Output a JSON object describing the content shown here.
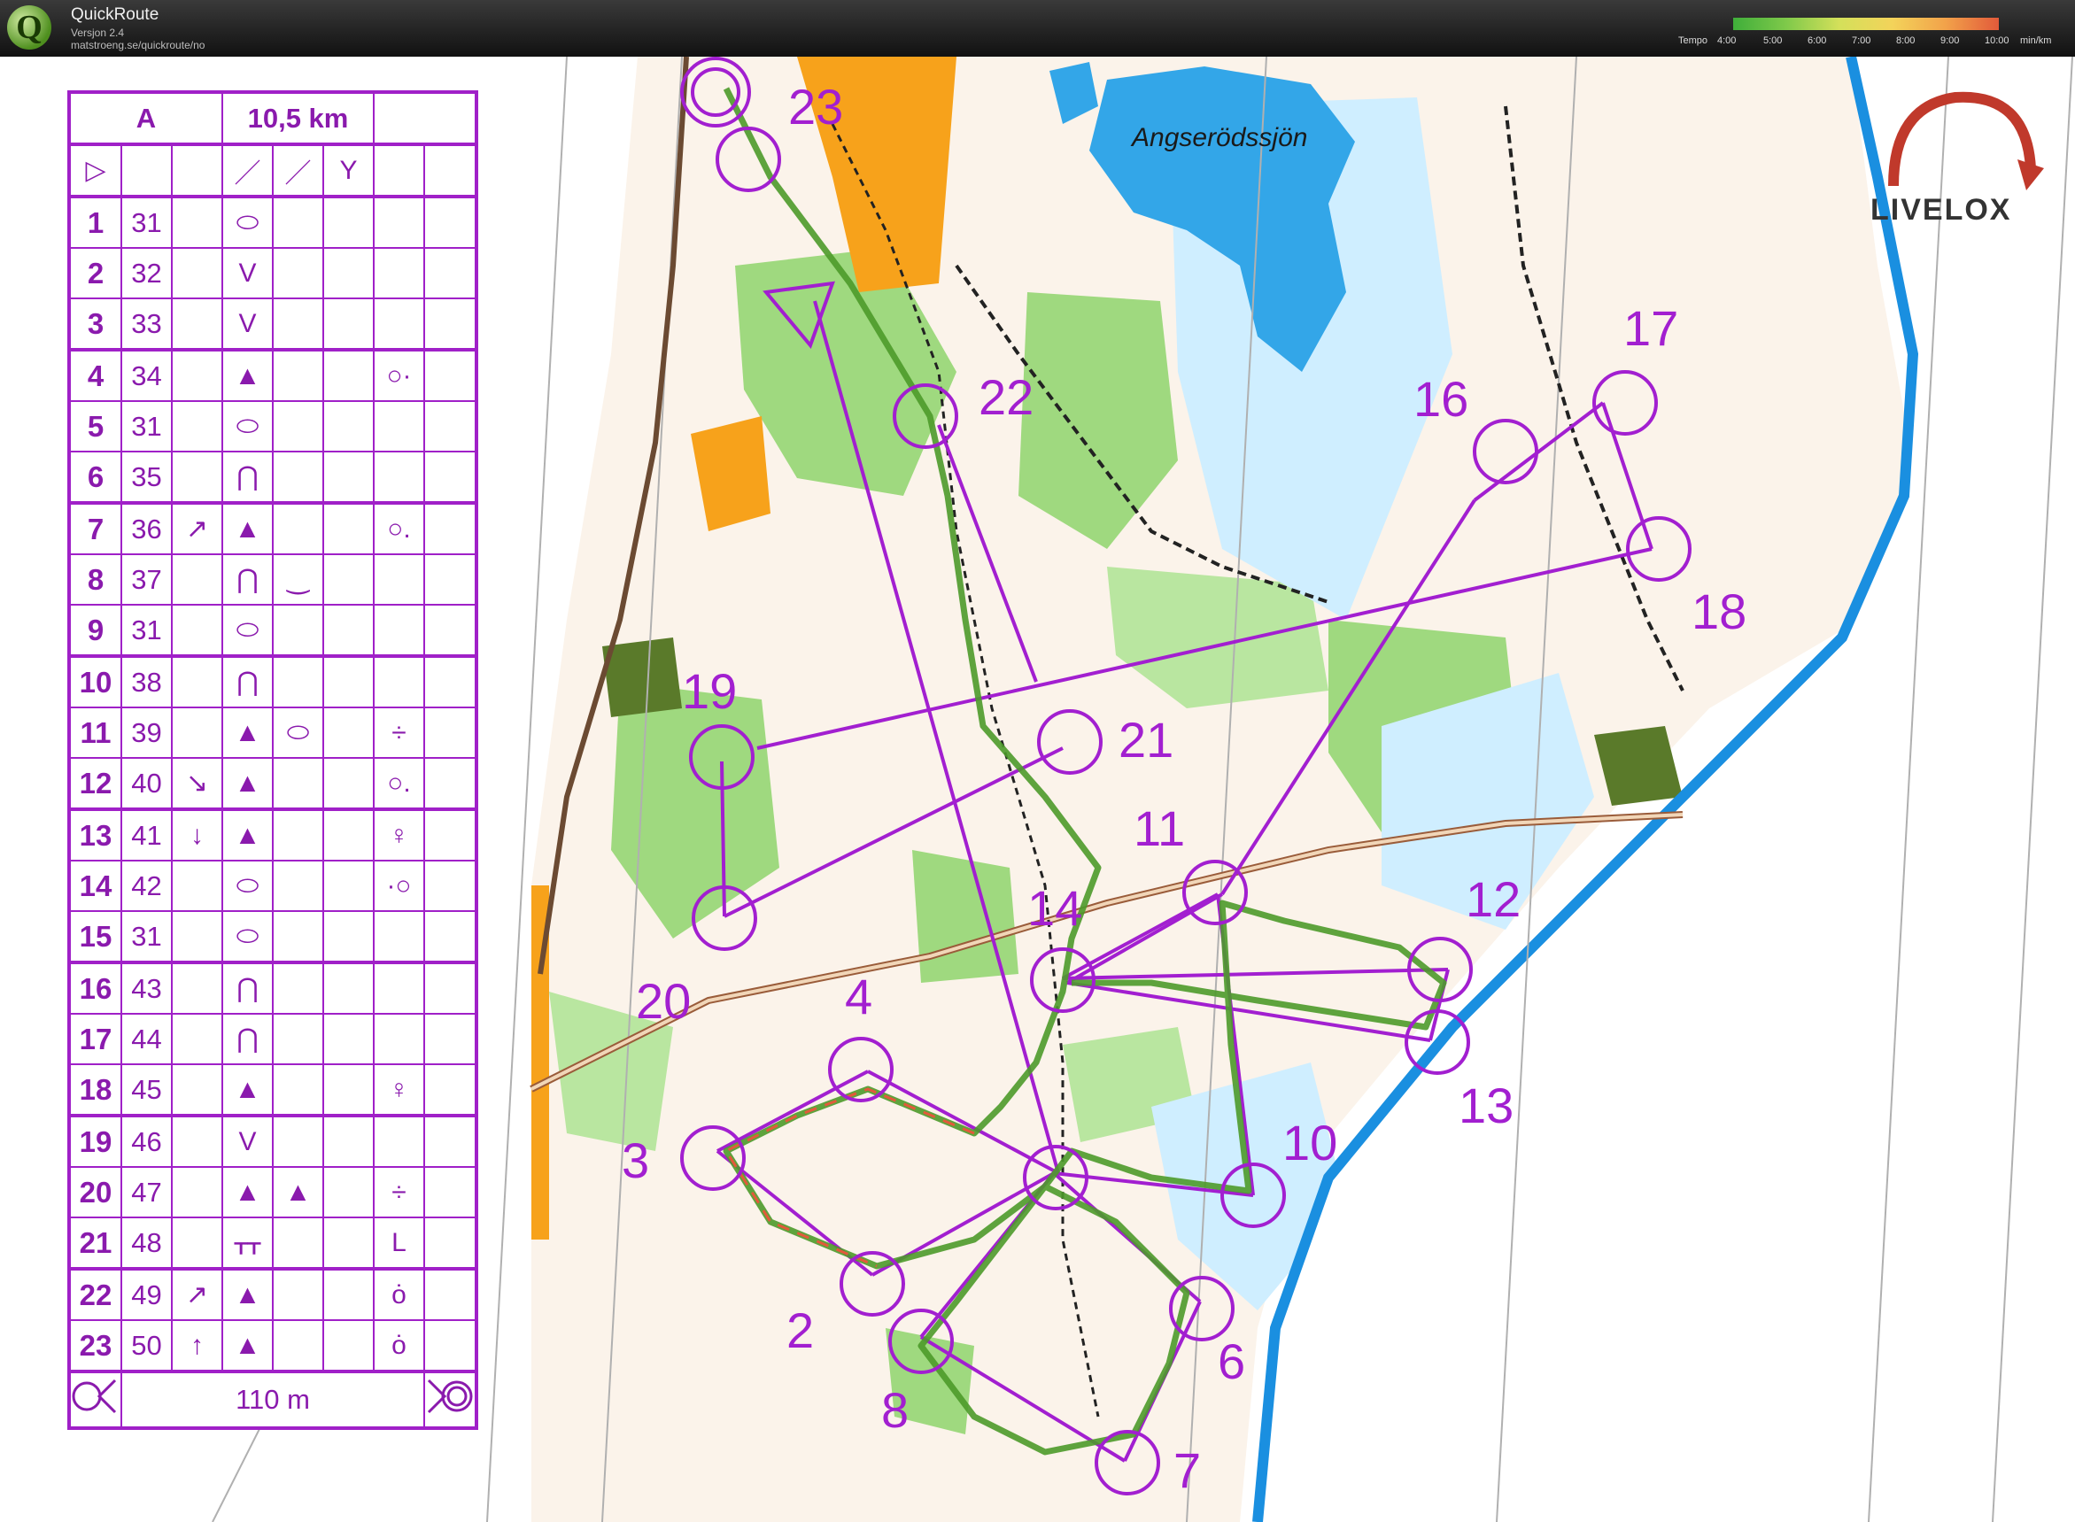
{
  "app": {
    "title": "QuickRoute",
    "version": "Versjon 2.4",
    "url": "matstroeng.se/quickroute/no",
    "logo_letter": "Q"
  },
  "tempo_scale": {
    "label": "Tempo",
    "ticks": [
      "4:00",
      "5:00",
      "6:00",
      "7:00",
      "8:00",
      "9:00",
      "10:00"
    ],
    "unit": "min/km"
  },
  "map": {
    "lake_name": "Angserödssjön",
    "brand": "LIVELOX",
    "controls": [
      {
        "label": "2",
        "color": "#a21fd0"
      },
      {
        "label": "3",
        "color": "#a21fd0"
      },
      {
        "label": "4",
        "color": "#a21fd0"
      },
      {
        "label": "6",
        "color": "#a21fd0"
      },
      {
        "label": "7",
        "color": "#a21fd0"
      },
      {
        "label": "8",
        "color": "#a21fd0"
      },
      {
        "label": "10",
        "color": "#a21fd0"
      },
      {
        "label": "11",
        "color": "#a21fd0"
      },
      {
        "label": "12",
        "color": "#a21fd0"
      },
      {
        "label": "13",
        "color": "#a21fd0"
      },
      {
        "label": "14",
        "color": "#a21fd0"
      },
      {
        "label": "16",
        "color": "#a21fd0"
      },
      {
        "label": "17",
        "color": "#a21fd0"
      },
      {
        "label": "18",
        "color": "#a21fd0"
      },
      {
        "label": "19",
        "color": "#a21fd0"
      },
      {
        "label": "20",
        "color": "#a21fd0"
      },
      {
        "label": "21",
        "color": "#a21fd0"
      },
      {
        "label": "22",
        "color": "#a21fd0"
      },
      {
        "label": "23",
        "color": "#a21fd0"
      }
    ]
  },
  "control_descriptions": {
    "class": "A",
    "length": "10,5 km",
    "start_row": [
      "▷",
      "",
      "",
      "／",
      "／",
      "Y",
      "",
      ""
    ],
    "rows": [
      {
        "num": "1",
        "code": "31",
        "dir": "",
        "feat": "⬭",
        "feat2": "",
        "detail": ""
      },
      {
        "num": "2",
        "code": "32",
        "dir": "",
        "feat": "V",
        "feat2": "",
        "detail": ""
      },
      {
        "num": "3",
        "code": "33",
        "dir": "",
        "feat": "V",
        "feat2": "",
        "detail": ""
      },
      {
        "num": "4",
        "code": "34",
        "dir": "",
        "feat": "▲",
        "feat2": "",
        "detail": "○·"
      },
      {
        "num": "5",
        "code": "31",
        "dir": "",
        "feat": "⬭",
        "feat2": "",
        "detail": ""
      },
      {
        "num": "6",
        "code": "35",
        "dir": "",
        "feat": "⋂",
        "feat2": "",
        "detail": ""
      },
      {
        "num": "7",
        "code": "36",
        "dir": "↗",
        "feat": "▲",
        "feat2": "",
        "detail": "○."
      },
      {
        "num": "8",
        "code": "37",
        "dir": "",
        "feat": "⋂",
        "feat2": "‿",
        "detail": ""
      },
      {
        "num": "9",
        "code": "31",
        "dir": "",
        "feat": "⬭",
        "feat2": "",
        "detail": ""
      },
      {
        "num": "10",
        "code": "38",
        "dir": "",
        "feat": "⋂",
        "feat2": "",
        "detail": ""
      },
      {
        "num": "11",
        "code": "39",
        "dir": "",
        "feat": "▲",
        "feat2": "⬭",
        "detail": "÷"
      },
      {
        "num": "12",
        "code": "40",
        "dir": "↘",
        "feat": "▲",
        "feat2": "",
        "detail": "○."
      },
      {
        "num": "13",
        "code": "41",
        "dir": "↓",
        "feat": "▲",
        "feat2": "",
        "detail": "♀"
      },
      {
        "num": "14",
        "code": "42",
        "dir": "",
        "feat": "⬭",
        "feat2": "",
        "detail": "·○"
      },
      {
        "num": "15",
        "code": "31",
        "dir": "",
        "feat": "⬭",
        "feat2": "",
        "detail": ""
      },
      {
        "num": "16",
        "code": "43",
        "dir": "",
        "feat": "⋂",
        "feat2": "",
        "detail": ""
      },
      {
        "num": "17",
        "code": "44",
        "dir": "",
        "feat": "⋂",
        "feat2": "",
        "detail": ""
      },
      {
        "num": "18",
        "code": "45",
        "dir": "",
        "feat": "▲",
        "feat2": "",
        "detail": "♀"
      },
      {
        "num": "19",
        "code": "46",
        "dir": "",
        "feat": "V",
        "feat2": "",
        "detail": ""
      },
      {
        "num": "20",
        "code": "47",
        "dir": "",
        "feat": "▲",
        "feat2": "▲",
        "detail": "÷"
      },
      {
        "num": "21",
        "code": "48",
        "dir": "",
        "feat": "ᚁᚁ",
        "feat2": "",
        "detail": "L"
      },
      {
        "num": "22",
        "code": "49",
        "dir": "↗",
        "feat": "▲",
        "feat2": "",
        "detail": "ȯ"
      },
      {
        "num": "23",
        "code": "50",
        "dir": "↑",
        "feat": "▲",
        "feat2": "",
        "detail": "ȯ"
      }
    ],
    "finish_distance": "110 m"
  }
}
